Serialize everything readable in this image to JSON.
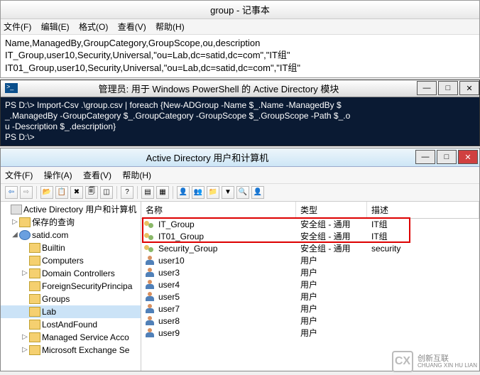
{
  "notepad": {
    "title": "group - 记事本",
    "menu": {
      "file": "文件(F)",
      "edit": "编辑(E)",
      "format": "格式(O)",
      "view": "查看(V)",
      "help": "帮助(H)"
    },
    "lines": [
      "Name,ManagedBy,GroupCategory,GroupScope,ou,description",
      "IT_Group,user10,Security,Universal,\"ou=Lab,dc=satid,dc=com\",\"IT组\"",
      "IT01_Group,user10,Security,Universal,\"ou=Lab,dc=satid,dc=com\",\"IT组\""
    ]
  },
  "powershell": {
    "title": "管理员: 用于 Windows PowerShell 的 Active Directory 模块",
    "lines": [
      "PS D:\\> Import-Csv .\\group.csv | foreach {New-ADGroup -Name $_.Name -ManagedBy $",
      "_.ManagedBy -GroupCategory $_.GroupCategory -GroupScope $_.GroupScope -Path $_.o",
      "u -Description $_.description}",
      "PS D:\\>"
    ]
  },
  "aduc": {
    "title": "Active Directory 用户和计算机",
    "menu": {
      "file": "文件(F)",
      "action": "操作(A)",
      "view": "查看(V)",
      "help": "帮助(H)"
    },
    "tree": {
      "root": "Active Directory 用户和计算机",
      "saved": "保存的查询",
      "domain": "satid.com",
      "nodes": [
        "Builtin",
        "Computers",
        "Domain Controllers",
        "ForeignSecurityPrincipa",
        "Groups",
        "Lab",
        "LostAndFound",
        "Managed Service Acco",
        "Microsoft Exchange Se"
      ]
    },
    "columns": {
      "name": "名称",
      "type": "类型",
      "desc": "描述"
    },
    "rows": [
      {
        "icon": "group",
        "name": "IT_Group",
        "type": "安全组 - 通用",
        "desc": "IT组"
      },
      {
        "icon": "group",
        "name": "IT01_Group",
        "type": "安全组 - 通用",
        "desc": "IT组"
      },
      {
        "icon": "group",
        "name": "Security_Group",
        "type": "安全组 - 通用",
        "desc": "security"
      },
      {
        "icon": "user",
        "name": "user10",
        "type": "用户",
        "desc": ""
      },
      {
        "icon": "user",
        "name": "user3",
        "type": "用户",
        "desc": ""
      },
      {
        "icon": "user",
        "name": "user4",
        "type": "用户",
        "desc": ""
      },
      {
        "icon": "user",
        "name": "user5",
        "type": "用户",
        "desc": ""
      },
      {
        "icon": "user",
        "name": "user7",
        "type": "用户",
        "desc": ""
      },
      {
        "icon": "user",
        "name": "user8",
        "type": "用户",
        "desc": ""
      },
      {
        "icon": "user",
        "name": "user9",
        "type": "用户",
        "desc": ""
      }
    ]
  },
  "watermark": {
    "brand": "创新互联",
    "sub": "CHUANG XIN HU LIAN"
  }
}
